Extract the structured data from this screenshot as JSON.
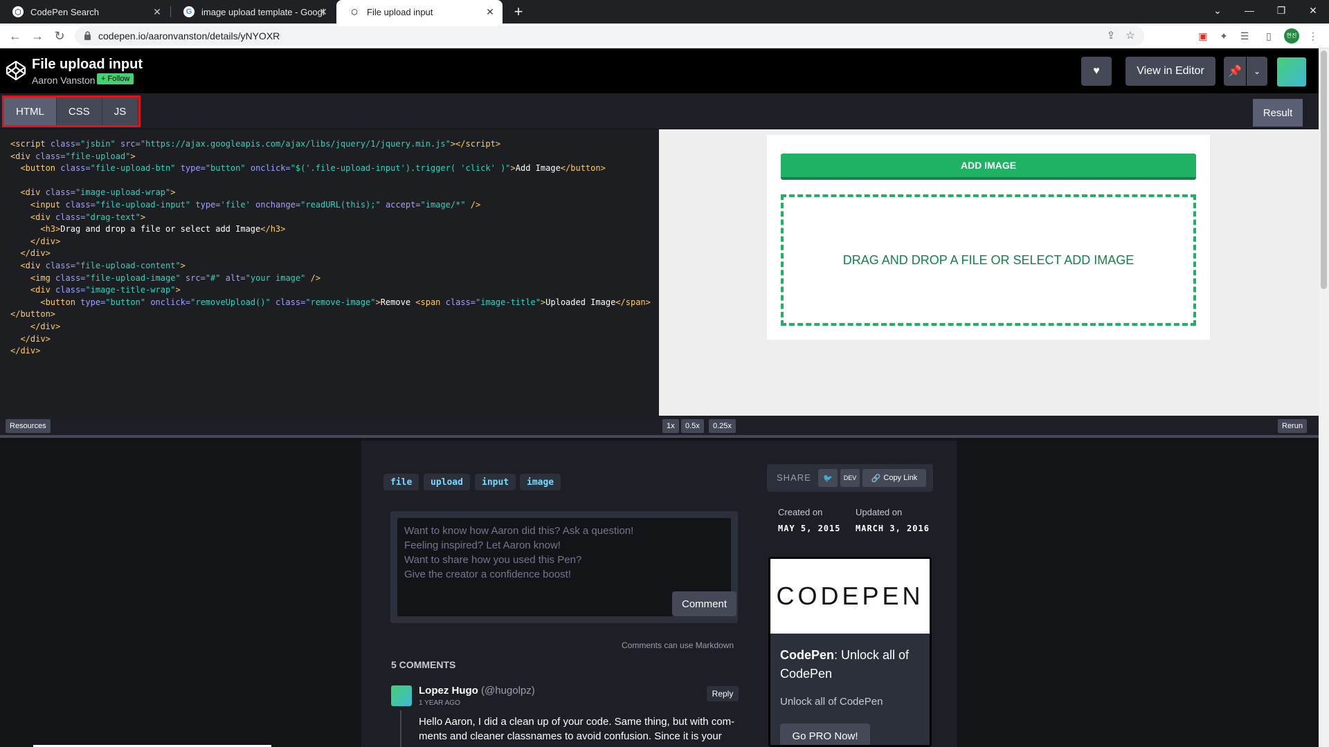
{
  "browser": {
    "tabs": [
      {
        "title": "CodePen Search"
      },
      {
        "title": "image upload template - Googl"
      },
      {
        "title": "File upload input"
      }
    ],
    "url": "codepen.io/aaronvanston/details/yNYOXR",
    "window_controls": [
      "chevron-down",
      "minimize",
      "restore",
      "close"
    ]
  },
  "pen": {
    "title": "File upload input",
    "author": "Aaron Vanston",
    "follow_label": "+ Follow",
    "view_in_editor": "View in Editor"
  },
  "editor": {
    "tabs": [
      {
        "label": "HTML"
      },
      {
        "label": "CSS"
      },
      {
        "label": "JS"
      }
    ],
    "result_label": "Result",
    "resources_label": "Resources",
    "zoom": [
      "1x",
      "0.5x",
      "0.25x"
    ],
    "rerun_label": "Rerun"
  },
  "preview": {
    "add_image_label": "ADD IMAGE",
    "drop_text": "DRAG AND DROP A FILE OR SELECT ADD IMAGE"
  },
  "details": {
    "tags": [
      "file",
      "upload",
      "input",
      "image"
    ],
    "comment_placeholder": "Want to know how Aaron did this? Ask a question!\nFeeling inspired? Let Aaron know!\nWant to share how you used this Pen?\nGive the creator a confidence boost!",
    "comment_button": "Comment",
    "markdown_note": "Comments can use Markdown",
    "comments_count": "5 COMMENTS",
    "first_comment": {
      "name": "Lopez Hugo",
      "handle": "(@hugolpz)",
      "time": "1 YEAR AGO",
      "reply": "Reply",
      "body": "Hello Aaron, I did a clean up of your code. Same thing, but with com-ments and cleaner classnames to avoid confusion. Since it is your"
    },
    "share": {
      "label": "SHARE",
      "dev_label": "DEV",
      "copy_link": "Copy Link"
    },
    "created_label": "Created on",
    "created_value": "MAY 5, 2015",
    "updated_label": "Updated on",
    "updated_value": "MARCH 3, 2016",
    "promo": {
      "logo": "CODEPEN",
      "title_bold": "CodePen",
      "title_rest": ": Unlock all of CodePen",
      "subtitle": "Unlock all of CodePen",
      "button": "Go PRO Now!"
    }
  },
  "colors": {
    "accent_green": "#1fb264",
    "follow_green": "#47cf73",
    "highlight_red": "#e0151c"
  }
}
